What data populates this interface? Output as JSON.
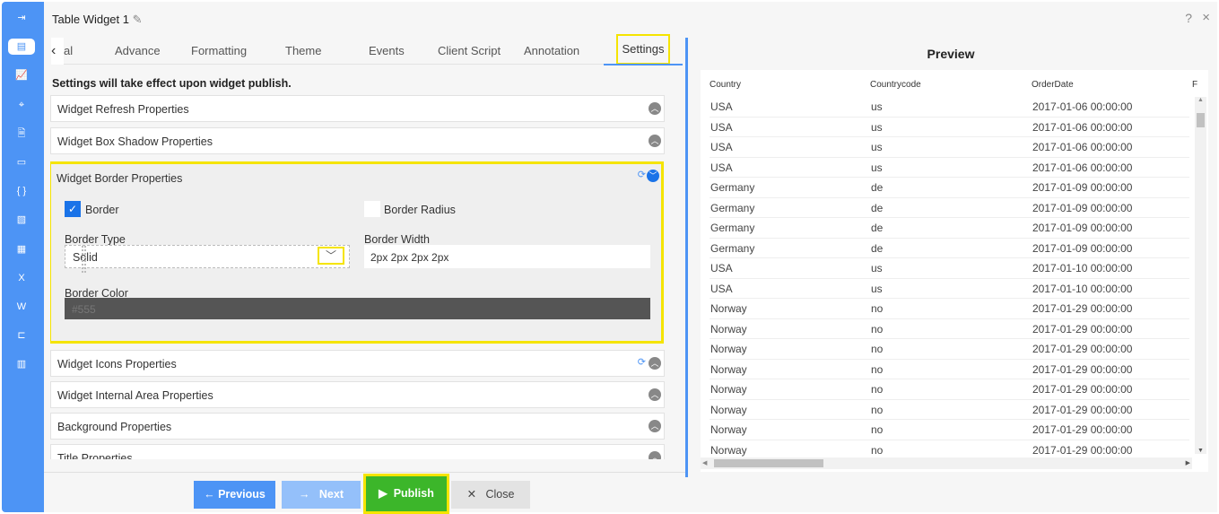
{
  "sidebar": {
    "icons": [
      "sign-in-icon",
      "table-icon",
      "chart-icon",
      "map-icon",
      "document-chart-icon",
      "id-card-icon",
      "code-braces-icon",
      "image-chart-icon",
      "calendar-icon",
      "excel-icon",
      "word-icon",
      "hierarchy-icon",
      "bar-chart-icon"
    ],
    "accent": "#4d94f5"
  },
  "header": {
    "title": "Table Widget 1",
    "help": "?",
    "close": "×"
  },
  "tabs": [
    {
      "label": "al"
    },
    {
      "label": "Advance"
    },
    {
      "label": "Formatting"
    },
    {
      "label": "Theme"
    },
    {
      "label": "Events"
    },
    {
      "label": "Client Script"
    },
    {
      "label": "Annotation"
    },
    {
      "label": "Settings",
      "active": true
    }
  ],
  "settings": {
    "note": "Settings will take effect upon widget publish.",
    "panels_top": [
      "Widget Refresh Properties",
      "Widget Box Shadow Properties"
    ],
    "border": {
      "title": "Widget Border Properties",
      "border_label": "Border",
      "border_checked": true,
      "radius_label": "Border Radius",
      "radius_checked": false,
      "type_label": "Border Type",
      "type_value": "Solid",
      "width_label": "Border Width",
      "width_value": "2px 2px 2px 2px",
      "color_label": "Border Color",
      "color_value": "#555"
    },
    "panels_bottom": [
      "Widget Icons Properties",
      "Widget Internal Area Properties",
      "Background Properties",
      "Title Properties"
    ]
  },
  "footer": {
    "previous": "Previous",
    "next": "Next",
    "publish": "Publish",
    "close": "Close"
  },
  "preview": {
    "title": "Preview",
    "columns": [
      "Country",
      "Countrycode",
      "OrderDate",
      "F"
    ],
    "rows": [
      [
        "USA",
        "us",
        "2017-01-06 00:00:00"
      ],
      [
        "USA",
        "us",
        "2017-01-06 00:00:00"
      ],
      [
        "USA",
        "us",
        "2017-01-06 00:00:00"
      ],
      [
        "USA",
        "us",
        "2017-01-06 00:00:00"
      ],
      [
        "Germany",
        "de",
        "2017-01-09 00:00:00"
      ],
      [
        "Germany",
        "de",
        "2017-01-09 00:00:00"
      ],
      [
        "Germany",
        "de",
        "2017-01-09 00:00:00"
      ],
      [
        "Germany",
        "de",
        "2017-01-09 00:00:00"
      ],
      [
        "USA",
        "us",
        "2017-01-10 00:00:00"
      ],
      [
        "USA",
        "us",
        "2017-01-10 00:00:00"
      ],
      [
        "Norway",
        "no",
        "2017-01-29 00:00:00"
      ],
      [
        "Norway",
        "no",
        "2017-01-29 00:00:00"
      ],
      [
        "Norway",
        "no",
        "2017-01-29 00:00:00"
      ],
      [
        "Norway",
        "no",
        "2017-01-29 00:00:00"
      ],
      [
        "Norway",
        "no",
        "2017-01-29 00:00:00"
      ],
      [
        "Norway",
        "no",
        "2017-01-29 00:00:00"
      ],
      [
        "Norway",
        "no",
        "2017-01-29 00:00:00"
      ],
      [
        "Norway",
        "no",
        "2017-01-29 00:00:00"
      ]
    ]
  }
}
